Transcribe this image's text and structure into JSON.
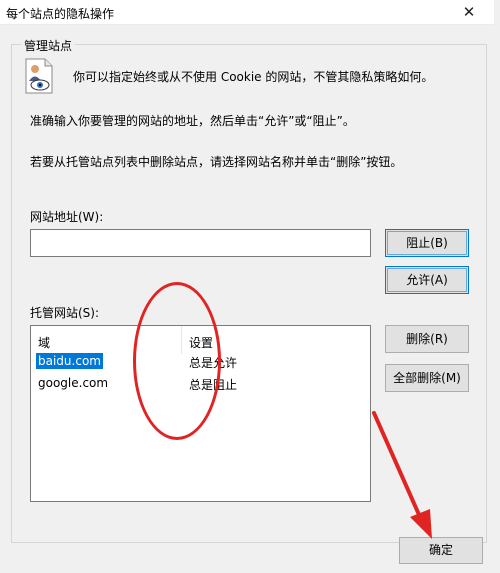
{
  "window": {
    "title": "每个站点的隐私操作",
    "close_glyph": "✕"
  },
  "group": {
    "title": "管理站点"
  },
  "info": {
    "line1": "你可以指定始终或从不使用 Cookie 的网站，不管其隐私策略如何。",
    "line2": "准确输入你要管理的网站的地址，然后单击“允许”或“阻止”。",
    "line3": "若要从托管站点列表中删除站点，请选择网站名称并单击“删除”按钮。"
  },
  "address": {
    "label": "网站地址(W):",
    "value": "",
    "placeholder": ""
  },
  "buttons": {
    "block": "阻止(B)",
    "allow": "允许(A)",
    "remove": "删除(R)",
    "remove_all": "全部删除(M)",
    "ok": "确定"
  },
  "managed": {
    "label": "托管网站(S):",
    "columns": [
      "域",
      "设置"
    ],
    "rows": [
      {
        "domain": "baidu.com",
        "setting": "总是允许",
        "selected": true
      },
      {
        "domain": "google.com",
        "setting": "总是阻止",
        "selected": false
      }
    ]
  },
  "icons": {
    "privacy_doc": "privacy-document-icon",
    "close": "close-icon"
  },
  "colors": {
    "annotation": "#e02424",
    "selection": "#0078d7",
    "dialog_bg": "#f0f0f0"
  }
}
